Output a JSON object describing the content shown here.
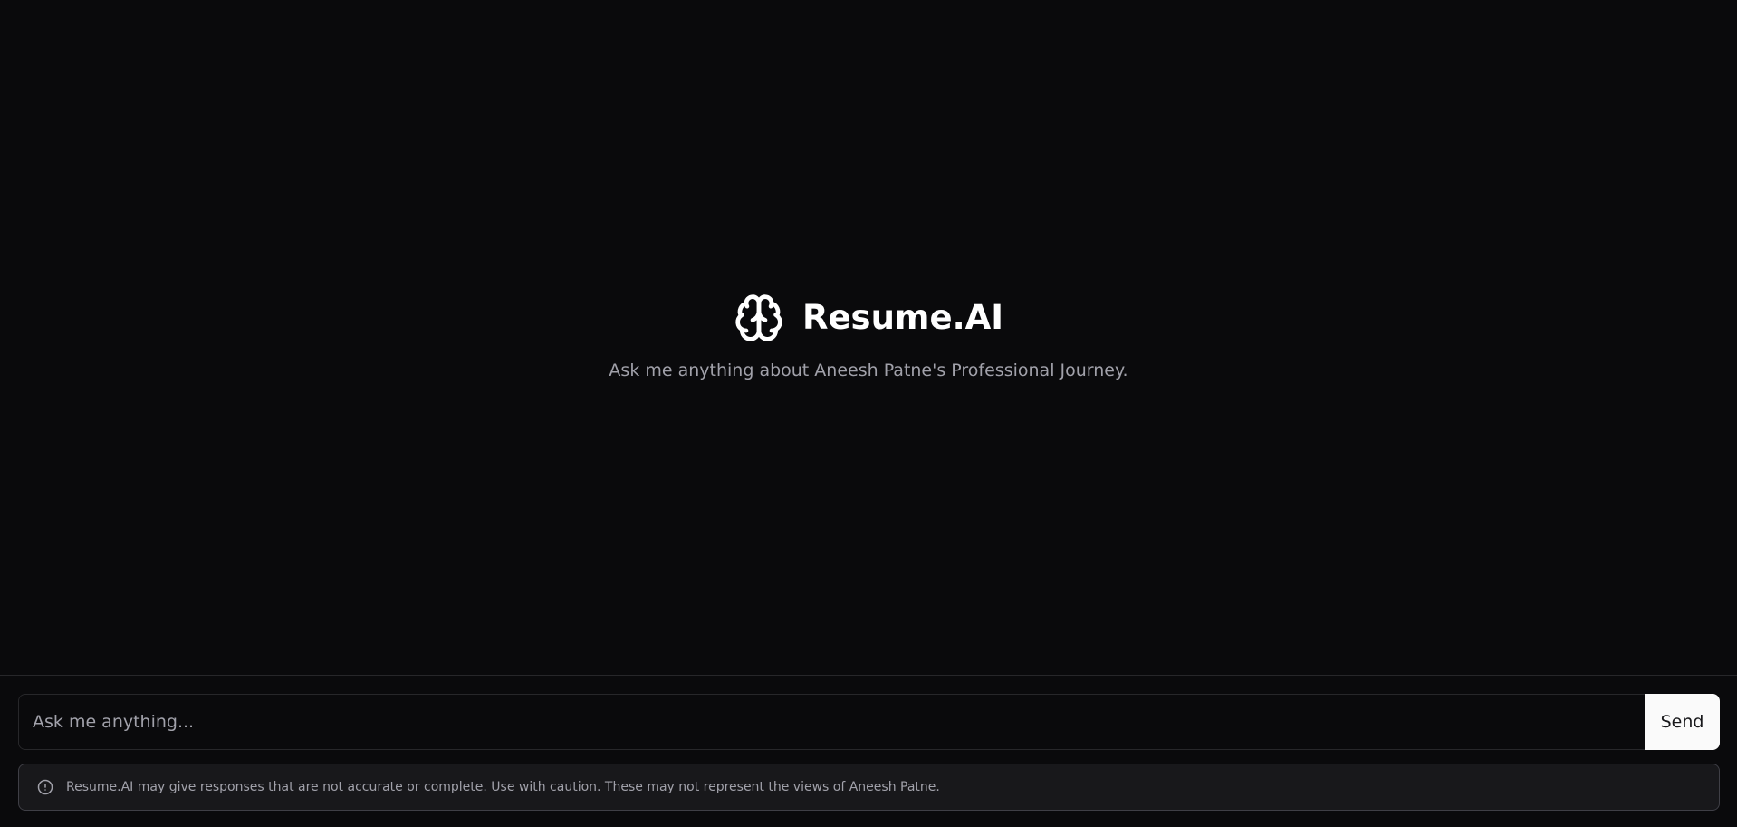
{
  "app": {
    "title": "Resume.AI",
    "subtitle": "Ask me anything about Aneesh Patne's Professional Journey.",
    "logo_icon": "brain-icon"
  },
  "chat": {
    "input_placeholder": "Ask me anything...",
    "input_value": "",
    "send_label": "Send"
  },
  "disclaimer": {
    "icon": "alert-circle-icon",
    "text": "Resume.AI may give responses that are not accurate or complete. Use with caution. These may not represent the views of Aneesh Patne."
  },
  "colors": {
    "background": "#0a0a0c",
    "title": "#ffffff",
    "muted_text": "#a1a1aa",
    "border": "#27272a",
    "send_button_bg": "#fafafa",
    "disclaimer_bg": "#18181b"
  }
}
